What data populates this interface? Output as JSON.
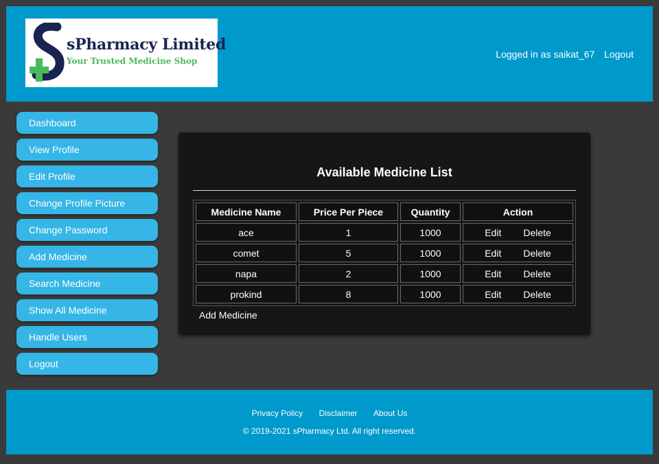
{
  "header": {
    "logo_title": "sPharmacy Limited",
    "logo_subtitle": "Your Trusted Medicine Shop",
    "logged_in_text": "Logged in as saikat_67",
    "logout_label": "Logout",
    "colors": {
      "header_bg": "#0099cc",
      "logo_navy": "#1a2450",
      "logo_green": "#4bb95a"
    }
  },
  "sidebar": {
    "items": [
      {
        "label": "Dashboard"
      },
      {
        "label": "View Profile"
      },
      {
        "label": "Edit Profile"
      },
      {
        "label": "Change Profile Picture"
      },
      {
        "label": "Change Password"
      },
      {
        "label": "Add Medicine"
      },
      {
        "label": "Search Medicine"
      },
      {
        "label": "Show All Medicine"
      },
      {
        "label": "Handle Users"
      },
      {
        "label": "Logout"
      }
    ],
    "color": "#35b6e6"
  },
  "main": {
    "title": "Available Medicine List",
    "columns": [
      "Medicine Name",
      "Price Per Piece",
      "Quantity",
      "Action"
    ],
    "rows": [
      {
        "name": "ace",
        "price": "1",
        "quantity": "1000",
        "edit": "Edit",
        "delete": "Delete"
      },
      {
        "name": "comet",
        "price": "5",
        "quantity": "1000",
        "edit": "Edit",
        "delete": "Delete"
      },
      {
        "name": "napa",
        "price": "2",
        "quantity": "1000",
        "edit": "Edit",
        "delete": "Delete"
      },
      {
        "name": "prokind",
        "price": "8",
        "quantity": "1000",
        "edit": "Edit",
        "delete": "Delete"
      }
    ],
    "add_link": "Add Medicine"
  },
  "footer": {
    "links": [
      "Privacy Policy",
      "Disclaimer",
      "About Us"
    ],
    "copyright": "© 2019-2021 sPharmacy Ltd. All right reserved."
  }
}
